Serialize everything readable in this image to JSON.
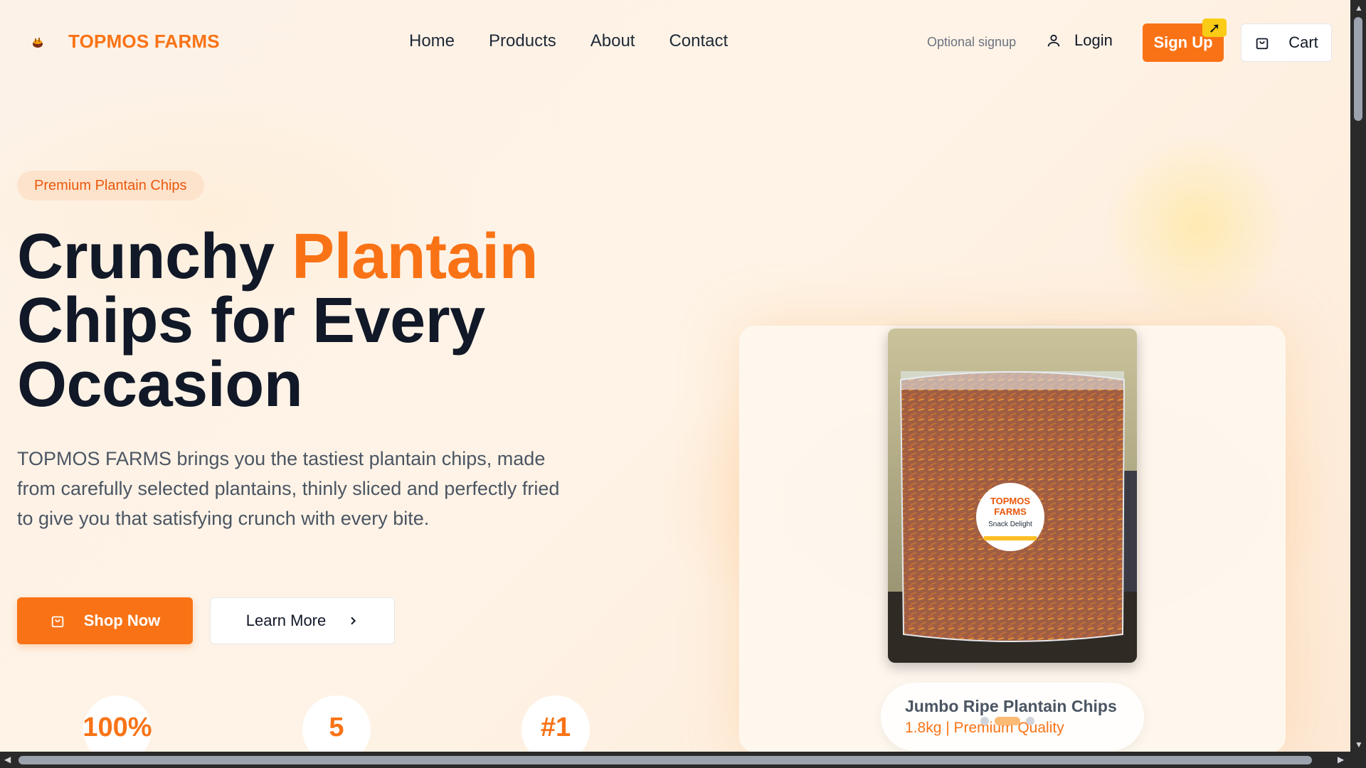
{
  "brand": {
    "name": "TOPMOS FARMS",
    "logo_icon": "plantain-basket-icon"
  },
  "nav": {
    "links": [
      "Home",
      "Products",
      "About",
      "Contact"
    ]
  },
  "header_actions": {
    "optional_signup": "Optional signup",
    "login_label": "Login",
    "signup_label": "Sign Up",
    "cart_label": "Cart"
  },
  "hero": {
    "badge": "Premium Plantain Chips",
    "headline_part1": "Crunchy ",
    "headline_accent": "Plantain",
    "headline_part2": "Chips for Every Occasion",
    "description": "TOPMOS FARMS brings you the tastiest plantain chips, made from carefully selected plantains, thinly sliced and perfectly fried to give you that satisfying crunch with every bite.",
    "shop_label": "Shop Now",
    "learn_label": "Learn More"
  },
  "stats": [
    "100%",
    "5",
    "#1"
  ],
  "product_card": {
    "title": "Jumbo Ripe Plantain Chips",
    "subtitle": "1.8kg | Premium Quality",
    "label_line1": "TOPMOS",
    "label_line2": "FARMS",
    "label_line3": "Snack Delight",
    "carousel_active_index": 1,
    "carousel_count": 3
  },
  "colors": {
    "accent": "#f97316",
    "text": "#111827",
    "muted": "#4b5563"
  }
}
